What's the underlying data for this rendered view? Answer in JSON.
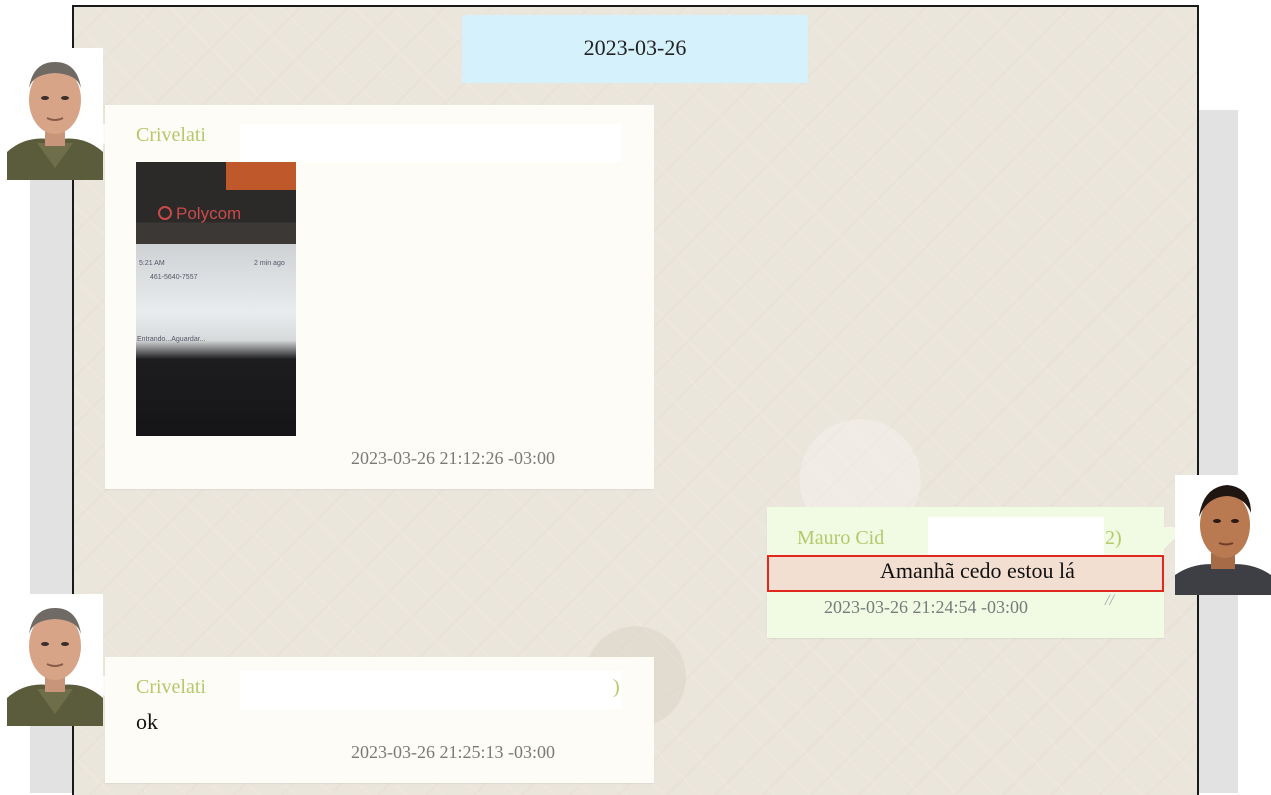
{
  "date_separator": "2023-03-26",
  "messages": [
    {
      "direction": "incoming",
      "sender": "Crivelati",
      "attachment": {
        "type": "image",
        "brand_text": "Polycom",
        "screen_lines": [
          "5:21 AM",
          "2 min ago",
          "461-5640-7557",
          "Entrando...Aguardar..."
        ]
      },
      "timestamp": "2023-03-26 21:12:26 -03:00"
    },
    {
      "direction": "outgoing",
      "sender": "Mauro Cid",
      "sender_suffix": "2)",
      "text": "Amanhã cedo estou lá",
      "timestamp": "2023-03-26 21:24:54 -03:00",
      "status_icon": "double-check-icon"
    },
    {
      "direction": "incoming",
      "sender": "Crivelati",
      "sender_suffix": ")",
      "text": "ok",
      "timestamp": "2023-03-26 21:25:13 -03:00"
    }
  ],
  "colors": {
    "chat_background": "#ebe6dc",
    "incoming_bubble": "#fdfcf7",
    "outgoing_bubble": "#f1fbe4",
    "date_pill": "#d5f1fb",
    "sender_name": "#b6c86a",
    "timestamp": "#7a7a7a",
    "highlight_border": "#e0281e"
  }
}
